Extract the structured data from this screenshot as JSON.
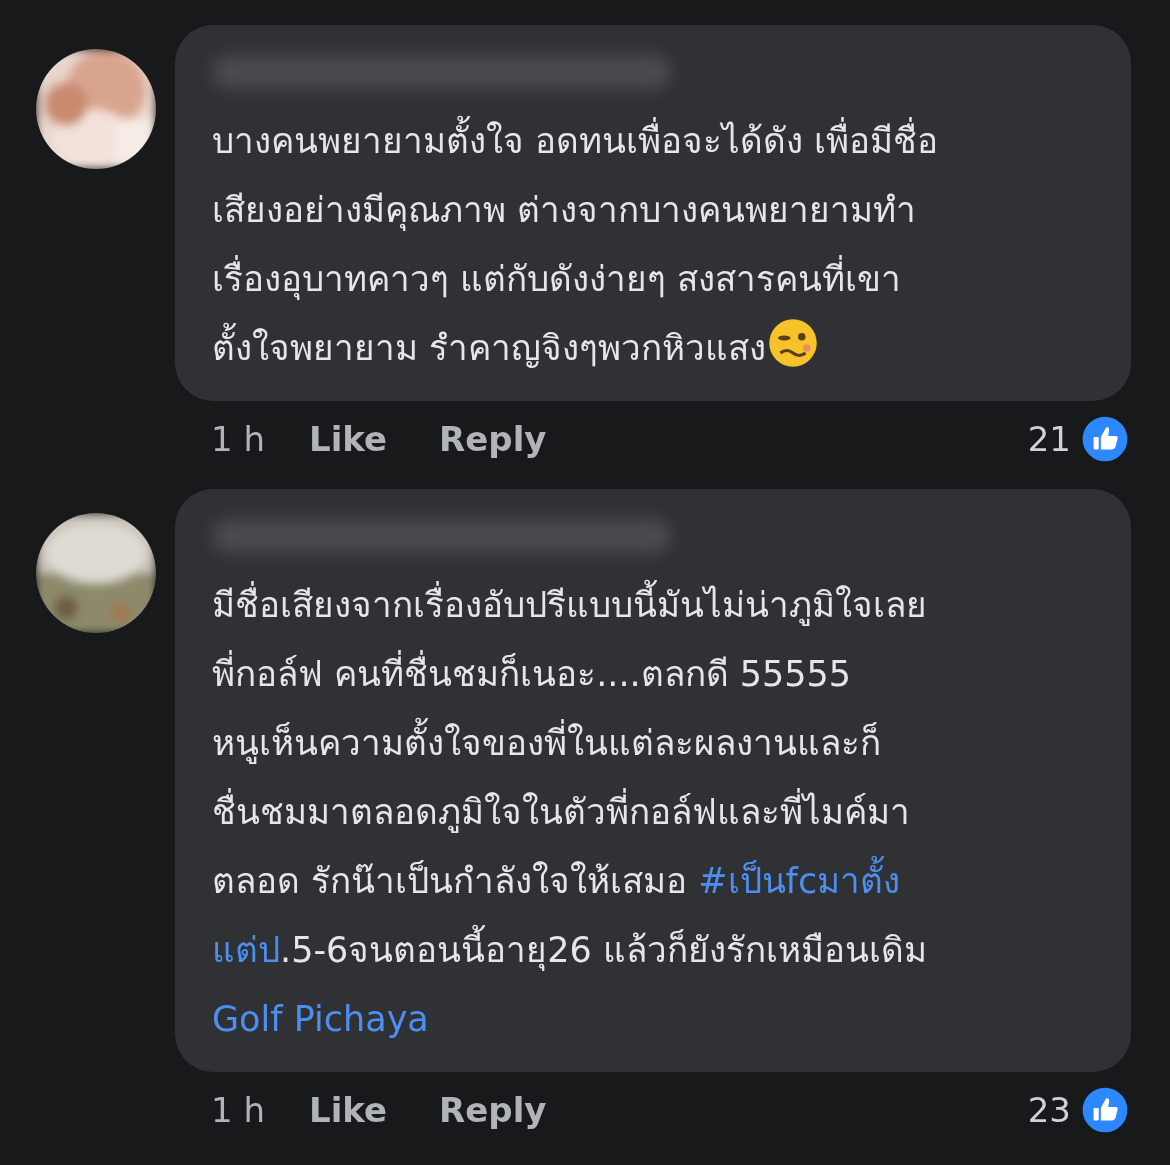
{
  "comments": [
    {
      "avatar": {
        "kind": "picture"
      },
      "lines": [
        [
          {
            "kind": "text",
            "text": "บางคนพยายามตั้งใจ อดทนเพื่อจะได้ดัง เพื่อมีชื่อ"
          }
        ],
        [
          {
            "kind": "text",
            "text": "เสียงอย่างมีคุณภาพ ต่างจากบางคนพยายามทำ"
          }
        ],
        [
          {
            "kind": "text",
            "text": "เรื่องอุบาทคาวๆ แต่กับดังง่ายๆ สงสารคนที่เขา"
          }
        ],
        [
          {
            "kind": "text",
            "text": "ตั้งใจพยายาม รำคาญจิงๆพวกหิวแสง"
          },
          {
            "kind": "emoji"
          }
        ]
      ],
      "time": "1 h",
      "like": "Like",
      "reply": "Reply",
      "reaction_count": "21"
    },
    {
      "avatar": {
        "kind": "picture"
      },
      "lines": [
        [
          {
            "kind": "text",
            "text": "มีชื่อเสียงจากเรื่องอับปรีแบบนี้มันไม่น่าภูมิใจเลย"
          }
        ],
        [
          {
            "kind": "text",
            "text": "พี่กอล์ฟ  คนที่ชื่นชมก็เนอะ....ตลกดี 55555"
          }
        ],
        [
          {
            "kind": "text",
            "text": "หนูเห็นความตั้งใจของพี่ในแต่ละผลงานและก็"
          }
        ],
        [
          {
            "kind": "text",
            "text": "ชื่นชมมาตลอดภูมิใจในตัวพี่กอล์ฟและพี่ไมค์มา"
          }
        ],
        [
          {
            "kind": "text",
            "text": "ตลอด รักน๊าเป็นกำลังใจให้เสมอ "
          },
          {
            "kind": "link",
            "text": "#เป็นfcมาตั้ง"
          }
        ],
        [
          {
            "kind": "link",
            "text": "แต่ป"
          },
          {
            "kind": "text",
            "text": ".5-6จนตอนนี้อายุ26 แล้วก็ยังรักเหมือนเดิม"
          }
        ],
        [
          {
            "kind": "link",
            "text": "Golf Pichaya"
          }
        ]
      ],
      "time": "1 h",
      "like": "Like",
      "reply": "Reply",
      "reaction_count": "23"
    }
  ]
}
